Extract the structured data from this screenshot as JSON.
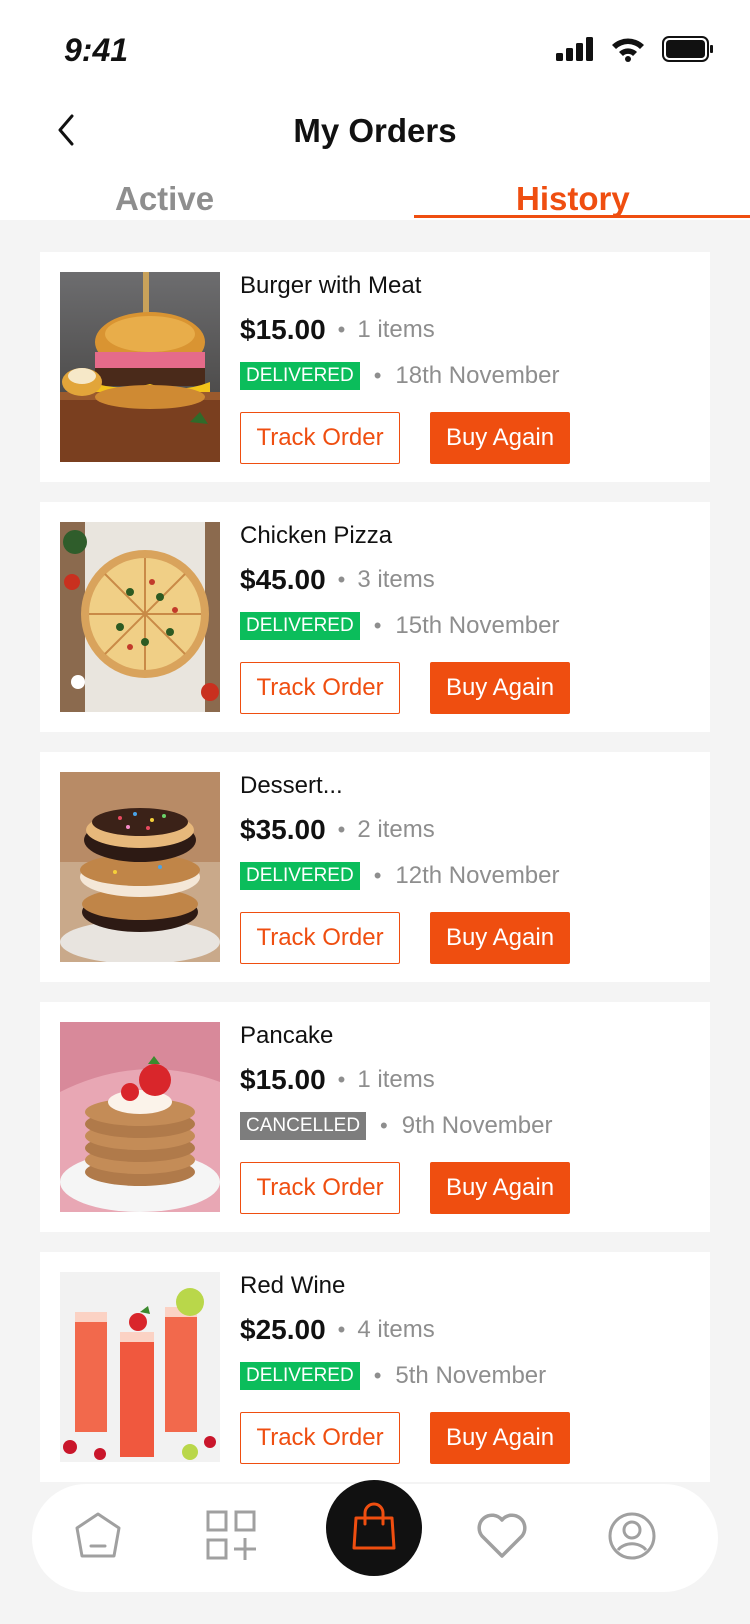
{
  "status_bar": {
    "time": "9:41"
  },
  "header": {
    "title": "My Orders"
  },
  "tabs": [
    {
      "label": "Active"
    },
    {
      "label": "History"
    }
  ],
  "colors": {
    "accent": "#ef4e10",
    "delivered": "#0bbd5b",
    "cancelled": "#7d7d7d"
  },
  "orders": [
    {
      "name": "Burger with Meat",
      "price": "$15.00",
      "items": "1 items",
      "status": "DELIVERED",
      "date": "18th November",
      "track_label": "Track Order",
      "buy_label": "Buy Again"
    },
    {
      "name": "Chicken Pizza",
      "price": "$45.00",
      "items": "3 items",
      "status": "DELIVERED",
      "date": "15th November",
      "track_label": "Track Order",
      "buy_label": "Buy Again"
    },
    {
      "name": "Dessert...",
      "price": "$35.00",
      "items": "2 items",
      "status": "DELIVERED",
      "date": "12th November",
      "track_label": "Track Order",
      "buy_label": "Buy Again"
    },
    {
      "name": "Pancake",
      "price": "$15.00",
      "items": "1 items",
      "status": "CANCELLED",
      "date": "9th November",
      "track_label": "Track Order",
      "buy_label": "Buy Again"
    },
    {
      "name": "Red Wine",
      "price": "$25.00",
      "items": "4 items",
      "status": "DELIVERED",
      "date": "5th November",
      "track_label": "Track Order",
      "buy_label": "Buy Again"
    }
  ],
  "bottom_nav": {
    "items": [
      "home-icon",
      "apps-add-icon",
      "shopping-bag-icon",
      "heart-icon",
      "profile-icon"
    ]
  }
}
